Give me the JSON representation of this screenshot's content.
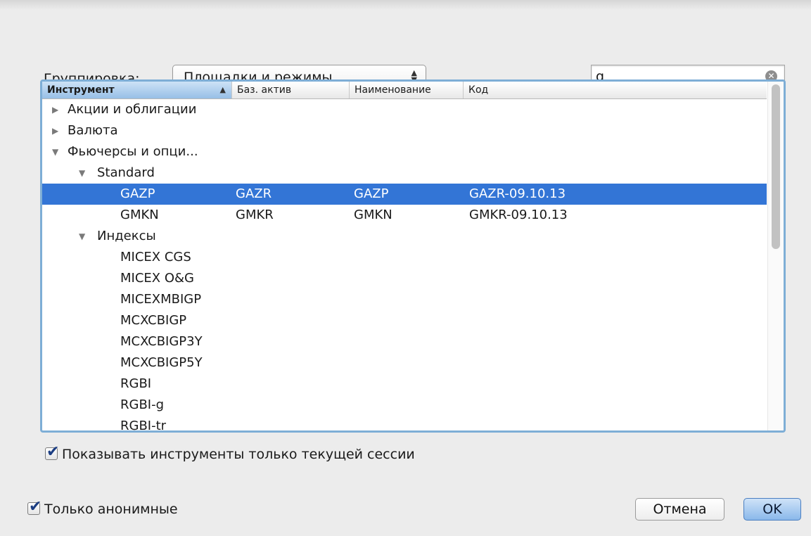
{
  "grouping": {
    "label": "Группировка:",
    "selected": "Площадки и режимы",
    "arrows": "⌃⌄"
  },
  "search": {
    "value": "g",
    "clear_glyph": "✕"
  },
  "table": {
    "columns": [
      "Инструмент",
      "Баз. актив",
      "Наименование",
      "Код"
    ],
    "sort_indicator": "▲",
    "rows": [
      {
        "level": 0,
        "disclosure": "▶",
        "name": "Акции и облигации",
        "base": "",
        "title": "",
        "code": "",
        "selected": false
      },
      {
        "level": 0,
        "disclosure": "▶",
        "name": "Валюта",
        "base": "",
        "title": "",
        "code": "",
        "selected": false
      },
      {
        "level": 0,
        "disclosure": "▼",
        "name": "Фьючерсы и опци...",
        "base": "",
        "title": "",
        "code": "",
        "selected": false
      },
      {
        "level": 1,
        "disclosure": "▼",
        "name": "Standard",
        "base": "",
        "title": "",
        "code": "",
        "selected": false
      },
      {
        "level": 2,
        "disclosure": "",
        "name": "GAZP",
        "base": "GAZR",
        "title": "GAZP",
        "code": "GAZR-09.10.13",
        "selected": true
      },
      {
        "level": 2,
        "disclosure": "",
        "name": "GMKN",
        "base": "GMKR",
        "title": "GMKN",
        "code": "GMKR-09.10.13",
        "selected": false
      },
      {
        "level": 1,
        "disclosure": "▼",
        "name": "Индексы",
        "base": "",
        "title": "",
        "code": "",
        "selected": false
      },
      {
        "level": 2,
        "disclosure": "",
        "name": "MICEX CGS",
        "base": "",
        "title": "",
        "code": "",
        "selected": false
      },
      {
        "level": 2,
        "disclosure": "",
        "name": "MICEX O&G",
        "base": "",
        "title": "",
        "code": "",
        "selected": false
      },
      {
        "level": 2,
        "disclosure": "",
        "name": "MICEXMBIGP",
        "base": "",
        "title": "",
        "code": "",
        "selected": false
      },
      {
        "level": 2,
        "disclosure": "",
        "name": "MCXCBIGP",
        "base": "",
        "title": "",
        "code": "",
        "selected": false
      },
      {
        "level": 2,
        "disclosure": "",
        "name": "MCXCBIGP3Y",
        "base": "",
        "title": "",
        "code": "",
        "selected": false
      },
      {
        "level": 2,
        "disclosure": "",
        "name": "MCXCBIGP5Y",
        "base": "",
        "title": "",
        "code": "",
        "selected": false
      },
      {
        "level": 2,
        "disclosure": "",
        "name": "RGBI",
        "base": "",
        "title": "",
        "code": "",
        "selected": false
      },
      {
        "level": 2,
        "disclosure": "",
        "name": "RGBI-g",
        "base": "",
        "title": "",
        "code": "",
        "selected": false
      },
      {
        "level": 2,
        "disclosure": "",
        "name": "RGBI-tr",
        "base": "",
        "title": "",
        "code": "",
        "selected": false
      }
    ]
  },
  "options": {
    "current_session_only": {
      "label": "Показывать инструменты только текущей сессии",
      "checked": true,
      "mark": "✔"
    },
    "anonymous_only": {
      "label": "Только анонимные",
      "checked": true,
      "mark": "✔"
    }
  },
  "buttons": {
    "cancel": "Отмена",
    "ok": "OK"
  },
  "colors": {
    "selection": "#3375d6",
    "focus_ring": "#7eaed6",
    "sorted_header": "#97bfe6"
  }
}
